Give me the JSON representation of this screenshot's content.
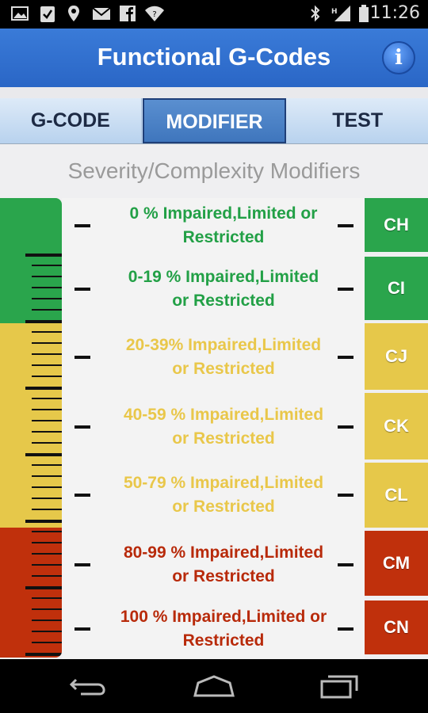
{
  "status_bar": {
    "time": "11:26",
    "left_icons": [
      "image-icon",
      "clipboard-check-icon",
      "maps-icon",
      "mail-icon",
      "facebook-icon",
      "wifi-question-icon"
    ],
    "right_icons": [
      "bluetooth-icon",
      "signal-icon",
      "battery-icon"
    ]
  },
  "header": {
    "title": "Functional G-Codes",
    "info_glyph": "i"
  },
  "tabs": [
    {
      "label": "G-CODE",
      "active": false
    },
    {
      "label": "MODIFIER",
      "active": true
    },
    {
      "label": "TEST",
      "active": false
    }
  ],
  "section_title": "Severity/Complexity Modifiers",
  "colors": {
    "green": "#2aa54c",
    "yellow": "#e6c84a",
    "red": "#c0300c",
    "green_text": "#22a046",
    "yellow_text": "#e9c74a",
    "red_text": "#b82a0a"
  },
  "modifiers": [
    {
      "code": "CH",
      "line1": "0 % Impaired,Limited or",
      "line2": "Restricted",
      "level": "green"
    },
    {
      "code": "CI",
      "line1": "0-19 % Impaired,Limited",
      "line2": "or Restricted",
      "level": "green"
    },
    {
      "code": "CJ",
      "line1": "20-39% Impaired,Limited",
      "line2": "or Restricted",
      "level": "yellow"
    },
    {
      "code": "CK",
      "line1": "40-59 % Impaired,Limited",
      "line2": "or Restricted",
      "level": "yellow"
    },
    {
      "code": "CL",
      "line1": "50-79 % Impaired,Limited",
      "line2": "or Restricted",
      "level": "yellow"
    },
    {
      "code": "CM",
      "line1": "80-99 % Impaired,Limited",
      "line2": "or Restricted",
      "level": "red"
    },
    {
      "code": "CN",
      "line1": "100 % Impaired,Limited or",
      "line2": "Restricted",
      "level": "red"
    }
  ],
  "nav": [
    "back-icon",
    "home-icon",
    "recent-apps-icon"
  ]
}
